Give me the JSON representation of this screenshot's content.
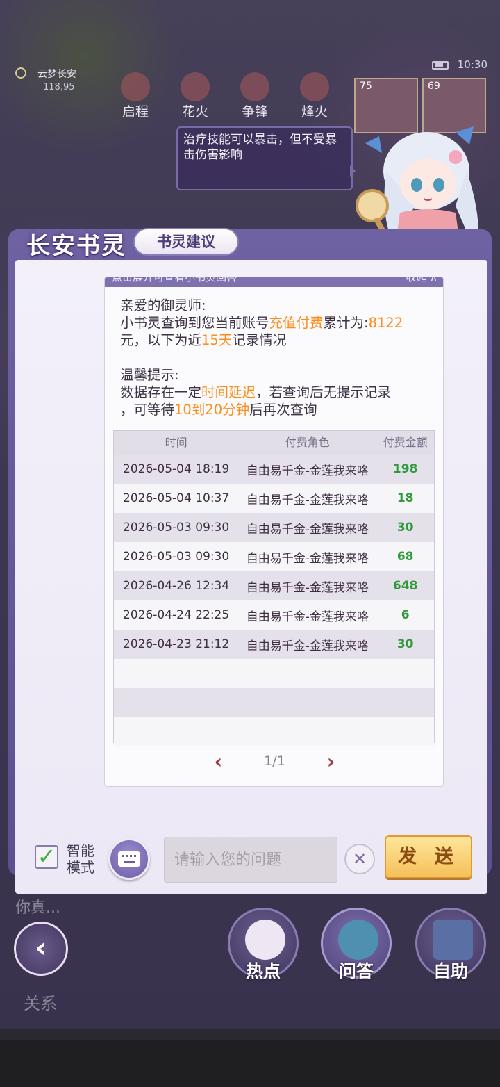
{
  "status": {
    "time": "10:30"
  },
  "location": {
    "name": "云梦长安",
    "coord": "118,95"
  },
  "top_menu": [
    "启程",
    "花火",
    "争锋",
    "烽火"
  ],
  "portraits": [
    "75",
    "69"
  ],
  "speech_bubble": "治疗技能可以暴击，但不受暴击伤害影响",
  "panel": {
    "title": "长安书灵",
    "tab": "书灵建议",
    "card_header_left": "点击展开可查看小书灵回答",
    "card_header_right": "收起 ∧"
  },
  "message": {
    "greeting": "亲爱的御灵师:",
    "l1_pre": "小书灵查询到您当前账号",
    "l1_hl": "充值付费",
    "l1_mid": "累计为:",
    "l1_amount": "8122",
    "l2_pre": "元，以下为近",
    "l2_hl": "15天",
    "l2_post": "记录情况",
    "tip_title": "温馨提示:",
    "t1_pre": "数据存在一定",
    "t1_hl": "时间延迟",
    "t1_post": "，若查询后无提示记录",
    "t2_pre": "，可等待",
    "t2_hl": "10到20分钟",
    "t2_post": "后再次查询"
  },
  "table": {
    "headers": [
      "时间",
      "付费角色",
      "付费金额"
    ],
    "rows": [
      [
        "2026-05-04 18:19",
        "自由易千金-金莲我来咯",
        "198"
      ],
      [
        "2026-05-04 10:37",
        "自由易千金-金莲我来咯",
        "18"
      ],
      [
        "2026-05-03 09:30",
        "自由易千金-金莲我来咯",
        "30"
      ],
      [
        "2026-05-03 09:30",
        "自由易千金-金莲我来咯",
        "68"
      ],
      [
        "2026-04-26 12:34",
        "自由易千金-金莲我来咯",
        "648"
      ],
      [
        "2026-04-24 22:25",
        "自由易千金-金莲我来咯",
        "6"
      ],
      [
        "2026-04-23 21:12",
        "自由易千金-金莲我来咯",
        "30"
      ],
      [
        "",
        "",
        ""
      ],
      [
        "",
        "",
        ""
      ],
      [
        "",
        "",
        ""
      ]
    ],
    "page": "1/1"
  },
  "input_bar": {
    "smart_mode_line1": "智能",
    "smart_mode_line2": "模式",
    "smart_mode_checked": true,
    "placeholder": "请输入您的问题",
    "send": "发 送"
  },
  "bottom_nav": {
    "hot": "热点",
    "qa": "问答",
    "self_help": "自助",
    "side_label": "关系",
    "side_label_top": "你真..."
  },
  "colors": {
    "accent_orange": "#ff8c1a",
    "amount_green": "#2e9a3a",
    "panel_purple": "#6f62a3"
  }
}
